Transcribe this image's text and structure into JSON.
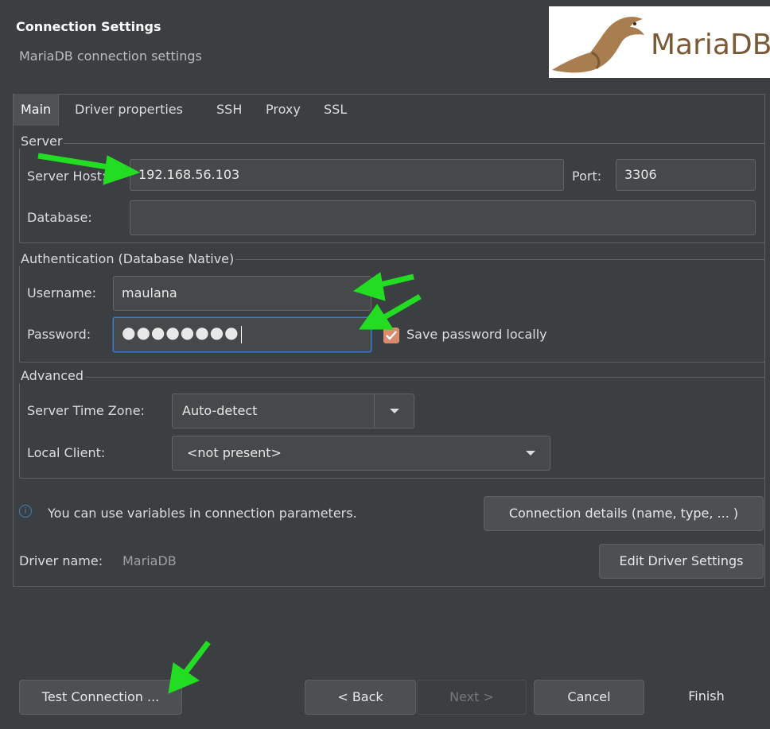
{
  "window": {
    "title": "Connection Settings",
    "subtitle": "MariaDB connection settings",
    "logo_text": "MariaDB"
  },
  "tabs": [
    {
      "label": "Main",
      "active": true
    },
    {
      "label": "Driver properties"
    },
    {
      "label": "SSH"
    },
    {
      "label": "Proxy"
    },
    {
      "label": "SSL"
    }
  ],
  "server": {
    "legend": "Server",
    "host_label": "Server Host:",
    "host_value": "192.168.56.103",
    "port_label": "Port:",
    "port_value": "3306",
    "database_label": "Database:",
    "database_value": ""
  },
  "auth": {
    "legend": "Authentication (Database Native)",
    "username_label": "Username:",
    "username_value": "maulana",
    "password_label": "Password:",
    "password_value": "●●●●●●●●",
    "save_password_label": "Save password locally",
    "save_password_checked": true
  },
  "advanced": {
    "legend": "Advanced",
    "timezone_label": "Server Time Zone:",
    "timezone_value": "Auto-detect",
    "local_client_label": "Local Client:",
    "local_client_value": "<not present>"
  },
  "info": {
    "text": "You can use variables in connection parameters.",
    "details_button": "Connection details (name, type, ... )",
    "driver_label": "Driver name:",
    "driver_value": "MariaDB",
    "edit_driver_button": "Edit Driver Settings"
  },
  "footer": {
    "test_button": "Test Connection ...",
    "back_button": "< Back",
    "next_button": "Next >",
    "cancel_button": "Cancel",
    "finish_button": "Finish"
  },
  "colors": {
    "background": "#3c3f41",
    "annotation_arrow": "#22dd22",
    "checkbox": "#d98b6c",
    "focus_border": "#3d7fc6"
  }
}
